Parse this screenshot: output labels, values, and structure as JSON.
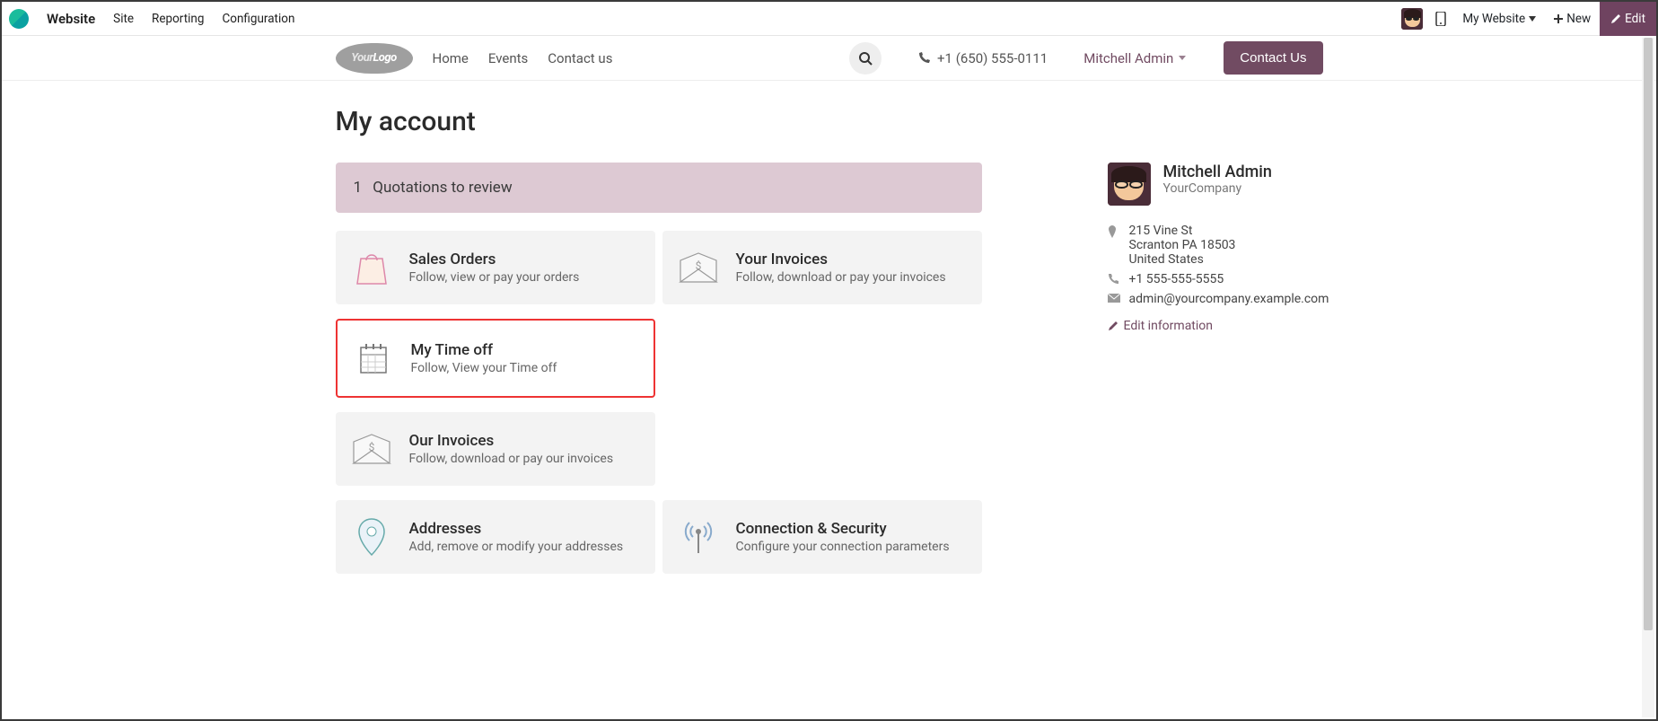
{
  "admin": {
    "brand": "Website",
    "menu": [
      "Site",
      "Reporting",
      "Configuration"
    ],
    "my_website": "My Website",
    "new": "New",
    "edit": "Edit"
  },
  "header": {
    "nav": [
      "Home",
      "Events",
      "Contact us"
    ],
    "phone": "+1 (650) 555-0111",
    "user": "Mitchell Admin",
    "contact_btn": "Contact Us"
  },
  "page": {
    "title": "My account",
    "alert_count": "1",
    "alert_text": "Quotations to review"
  },
  "cards": {
    "sales_orders": {
      "title": "Sales Orders",
      "sub": "Follow, view or pay your orders"
    },
    "your_invoices": {
      "title": "Your Invoices",
      "sub": "Follow, download or pay your invoices"
    },
    "my_time_off": {
      "title": "My Time off",
      "sub": "Follow, View your Time off"
    },
    "our_invoices": {
      "title": "Our Invoices",
      "sub": "Follow, download or pay our invoices"
    },
    "addresses": {
      "title": "Addresses",
      "sub": "Add, remove or modify your addresses"
    },
    "connection_security": {
      "title": "Connection & Security",
      "sub": "Configure your connection parameters"
    }
  },
  "sidebar": {
    "name": "Mitchell Admin",
    "company": "YourCompany",
    "addr_l1": "215 Vine St",
    "addr_l2": "Scranton PA 18503",
    "addr_l3": "United States",
    "phone": "+1 555-555-5555",
    "email": "admin@yourcompany.example.com",
    "edit": "Edit information"
  }
}
